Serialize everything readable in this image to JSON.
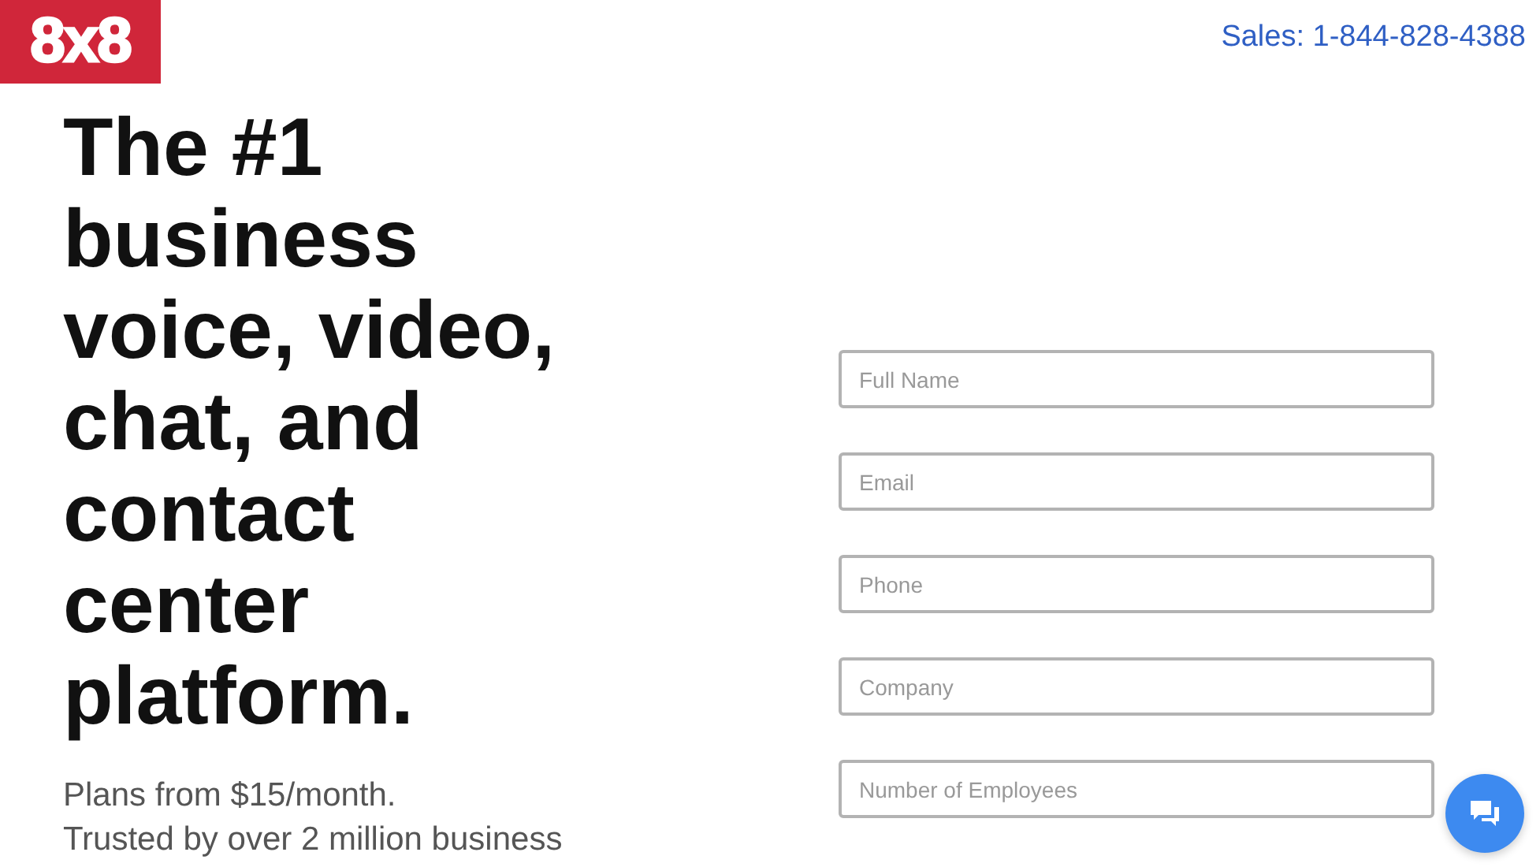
{
  "logo": {
    "text": "8x8"
  },
  "sales_phone": "Sales: 1-844-828-4388",
  "headline_lines": [
    "The #1",
    "business",
    "voice, video,",
    "chat, and",
    "contact",
    "center",
    "platform."
  ],
  "subtitle_lines": [
    "Plans from $15/month.",
    "Trusted by over 2 million business"
  ],
  "form_fields": [
    {
      "placeholder": "Full Name"
    },
    {
      "placeholder": "Email"
    },
    {
      "placeholder": "Phone"
    },
    {
      "placeholder": "Company"
    },
    {
      "placeholder": "Number of Employees"
    }
  ]
}
